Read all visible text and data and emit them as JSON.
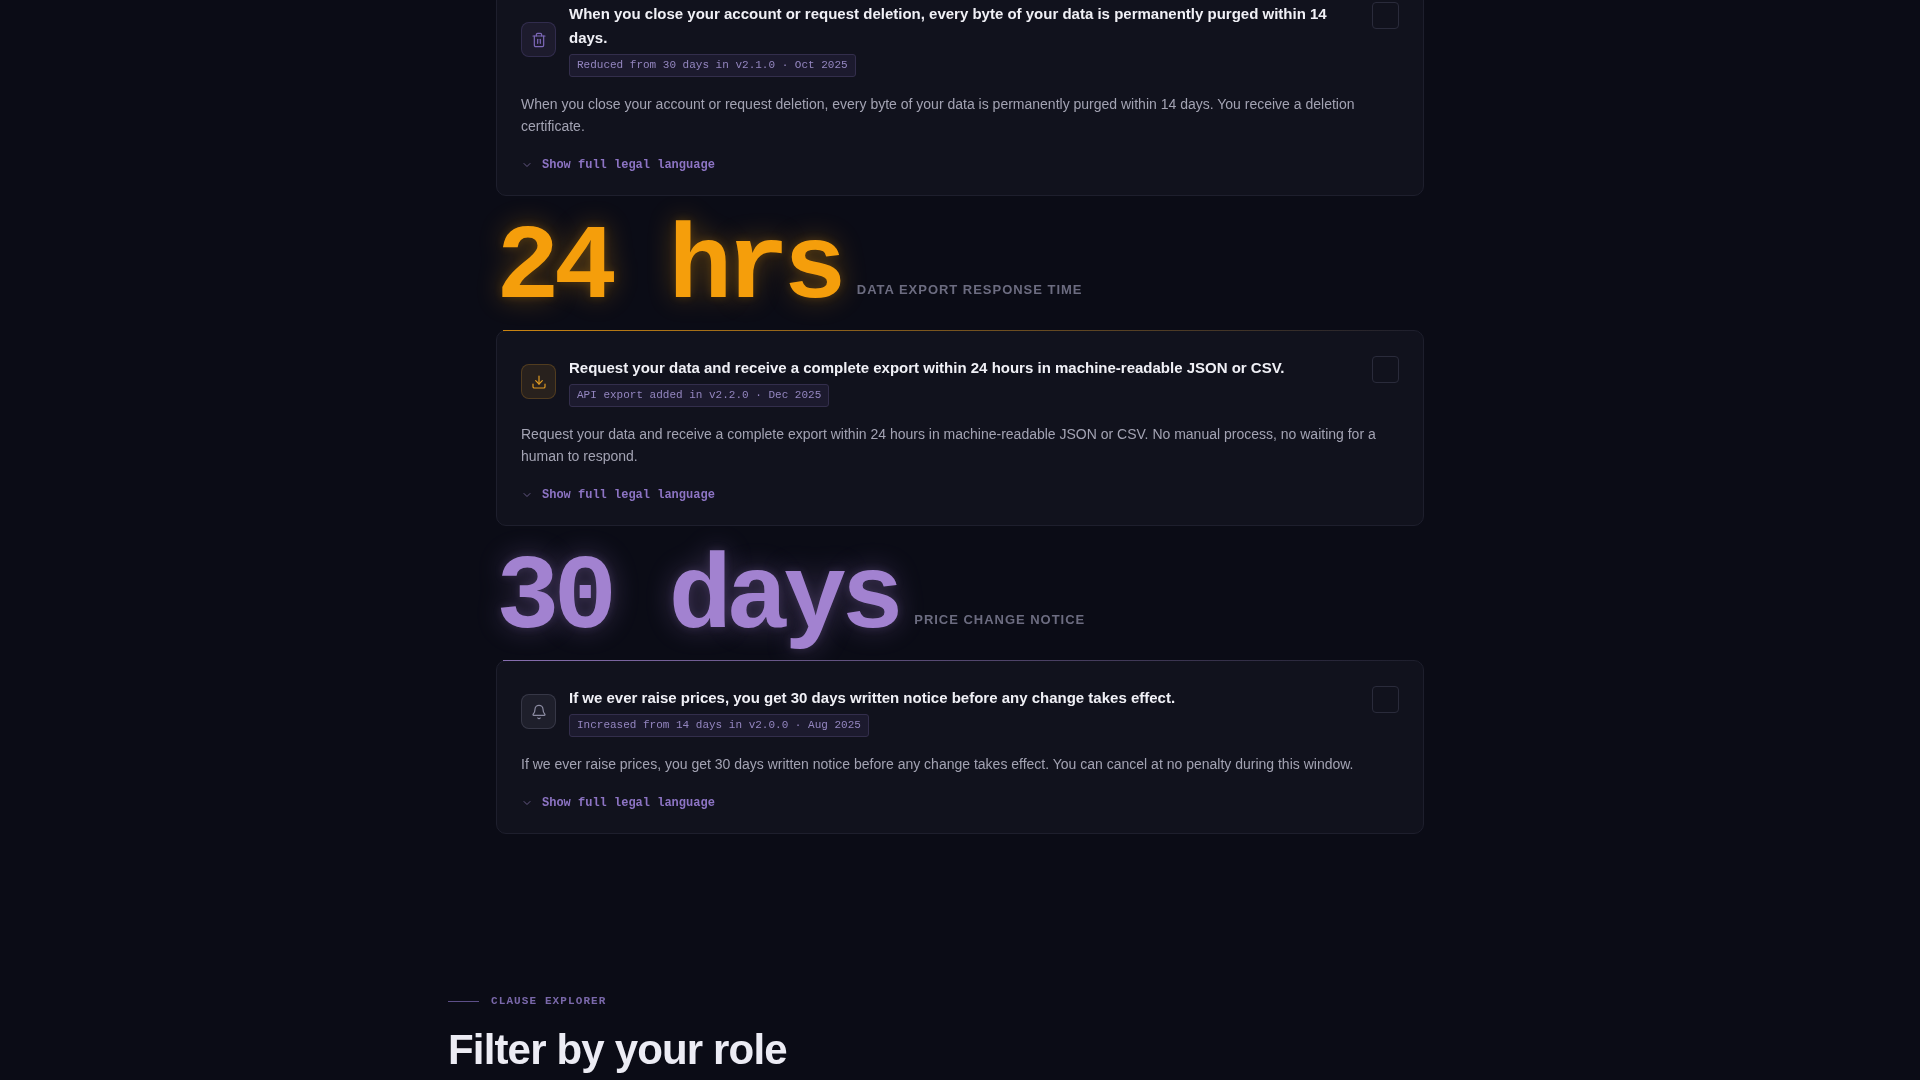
{
  "clauses": [
    {
      "kind": "deletion",
      "color": "#7d68b8",
      "title": "When you close your account or request deletion, every byte of your data is permanently purged within 14 days.",
      "tag": "Reduced from 30 days in v2.1.0 · Oct 2025",
      "summary": "When you close your account or request deletion, every byte of your data is permanently purged within 14 days. You receive a deletion certificate.",
      "toggle": {
        "label": "Show full legal language",
        "expanded": false
      },
      "checked": false
    },
    {
      "stat": {
        "value": "24 hrs",
        "label": "DATA EXPORT RESPONSE TIME",
        "color": "#f59e0b"
      },
      "kind": "export",
      "color": "#e09a22",
      "title": "Request your data and receive a complete export within 24 hours in machine-readable JSON or CSV.",
      "tag": "API export added in v2.2.0 · Dec 2025",
      "summary": "Request your data and receive a complete export within 24 hours in machine-readable JSON or CSV. No manual process, no waiting for a human to respond.",
      "toggle": {
        "label": "Show full legal language",
        "expanded": false
      },
      "checked": false
    },
    {
      "stat": {
        "value": "30 days",
        "label": "PRICE CHANGE NOTICE",
        "color": "#a282d0"
      },
      "kind": "pricing",
      "color": "#8c8ca2",
      "title": "If we ever raise prices, you get 30 days written notice before any change takes effect.",
      "tag": "Increased from 14 days in v2.0.0 · Aug 2025",
      "summary": "If we ever raise prices, you get 30 days written notice before any change takes effect. You can cancel at no penalty during this window.",
      "toggle": {
        "label": "Show full legal language",
        "expanded": false
      },
      "checked": false
    }
  ],
  "next_section": {
    "eyebrow": "CLAUSE EXPLORER",
    "heading": "Filter by your role"
  }
}
